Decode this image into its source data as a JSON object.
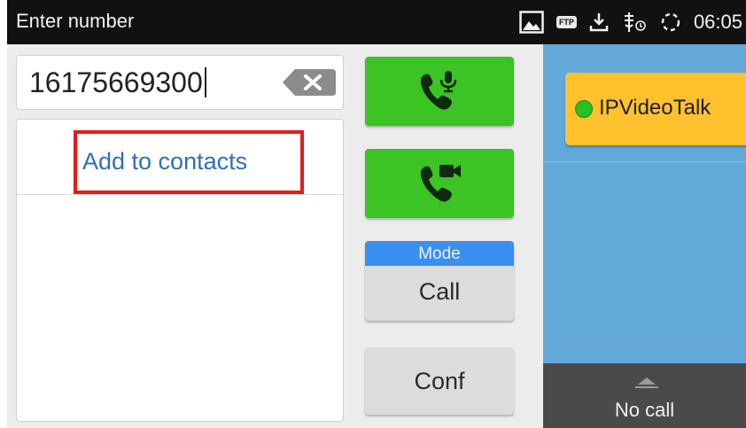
{
  "statusbar": {
    "title": "Enter number",
    "ftp_label": "FTP",
    "time": "06:05",
    "icons": [
      "image-icon",
      "ftp-icon",
      "download-icon",
      "usb-debug-icon",
      "sync-icon"
    ]
  },
  "dialer": {
    "number": "16175669300",
    "backspace_icon": "backspace-icon"
  },
  "suggestions": {
    "add_to_contacts": "Add to contacts",
    "highlight_color": "#e51b1b"
  },
  "actions": {
    "audio_call_icon": "phone-mic-icon",
    "video_call_icon": "phone-video-icon",
    "mode_label": "Mode",
    "mode_value": "Call",
    "conf_label": "Conf",
    "call_button_color": "#3bc423",
    "mode_header_color": "#3a8ff0"
  },
  "accounts": {
    "items": [
      {
        "label": "IPVideoTalk",
        "status_color": "#26c122"
      }
    ],
    "panel_color": "#62a9d9",
    "button_color": "#ffc12e"
  },
  "call_bar": {
    "status": "No call"
  }
}
